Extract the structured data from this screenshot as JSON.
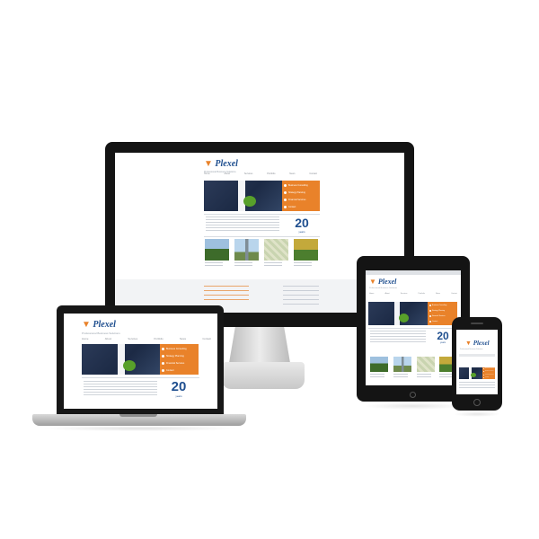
{
  "site": {
    "brand": "Plexel",
    "tagline": "Professional Business Solutions",
    "nav": [
      "Home",
      "About",
      "Services",
      "Portfolio",
      "News",
      "Contact"
    ],
    "menu": [
      "Business Consulting",
      "Strategy Planning",
      "Financial Services",
      "Contact"
    ],
    "anniversary_number": "20",
    "anniversary_label": "years",
    "thumbnails": [
      "field",
      "tower",
      "map",
      "meadow"
    ]
  },
  "colors": {
    "accent": "#e9822a",
    "brand_blue": "#1f4f8f",
    "hero_navy": "#1c2a45",
    "leaf_green": "#58a02a"
  },
  "devices": [
    "desktop-monitor",
    "laptop",
    "tablet",
    "smartphone"
  ]
}
